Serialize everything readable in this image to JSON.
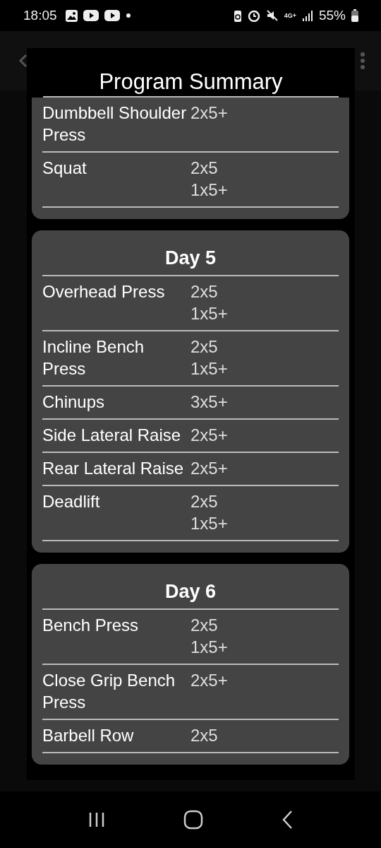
{
  "status_bar": {
    "time": "18:05",
    "network": "4G+",
    "battery": "55%"
  },
  "dialog": {
    "title": "Program Summary",
    "days": [
      {
        "rows": [
          {
            "exercise": "Dumbbell Shoulder Press",
            "sets": [
              "2x5+"
            ]
          },
          {
            "exercise": "Squat",
            "sets": [
              "2x5",
              "1x5+"
            ]
          }
        ]
      },
      {
        "title": "Day 5",
        "rows": [
          {
            "exercise": "Overhead Press",
            "sets": [
              "2x5",
              "1x5+"
            ]
          },
          {
            "exercise": "Incline Bench Press",
            "sets": [
              "2x5",
              "1x5+"
            ]
          },
          {
            "exercise": "Chinups",
            "sets": [
              "3x5+"
            ]
          },
          {
            "exercise": "Side Lateral Raise",
            "sets": [
              "2x5+"
            ]
          },
          {
            "exercise": "Rear Lateral Raise",
            "sets": [
              "2x5+"
            ]
          },
          {
            "exercise": "Deadlift",
            "sets": [
              "2x5",
              "1x5+"
            ]
          }
        ]
      },
      {
        "title": "Day 6",
        "rows": [
          {
            "exercise": "Bench Press",
            "sets": [
              "2x5",
              "1x5+"
            ]
          },
          {
            "exercise": "Close Grip Bench Press",
            "sets": [
              "2x5+"
            ]
          },
          {
            "exercise": "Barbell Row",
            "sets": [
              "2x5"
            ]
          }
        ]
      }
    ]
  }
}
